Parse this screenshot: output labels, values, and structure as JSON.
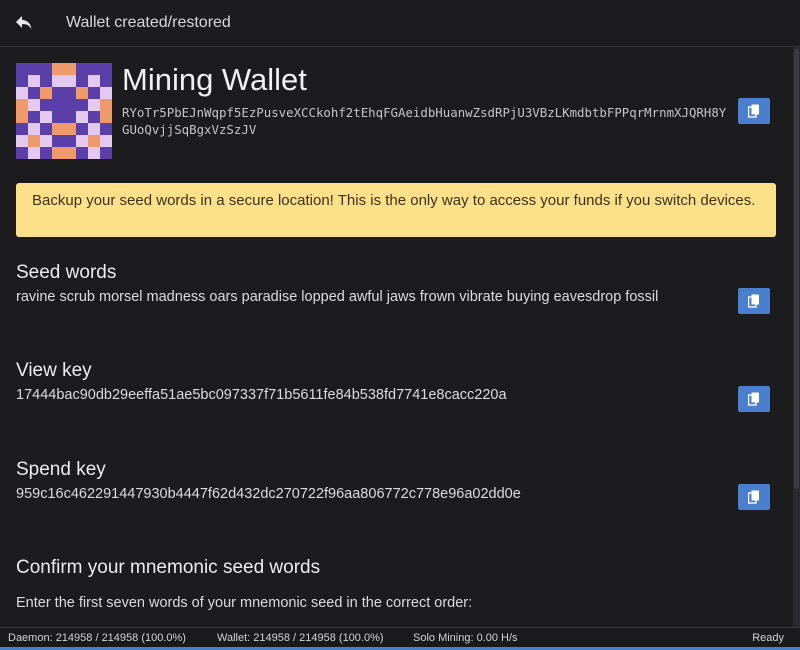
{
  "header": {
    "back_icon": "reply-arrow-icon",
    "title": "Wallet created/restored"
  },
  "wallet": {
    "name": "Mining Wallet",
    "address": "RYoTr5PbEJnWqpf5EzPusveXCCkohf2tEhqFGAeidbHuanwZsdRPjU3VBzLKmdbtbFPPqrMrnmXJQRH8YGUoQvjjSqBgxVzSzJV",
    "identicon_colors": {
      "purple": "#5b3fa8",
      "lilac": "#e3c9ef",
      "orange": "#ef9a6a"
    }
  },
  "warning": {
    "text": "Backup your seed words in a secure location! This is the only way to access your funds if you switch devices.",
    "color": "#fde08a"
  },
  "seed": {
    "title": "Seed words",
    "value": "ravine scrub morsel madness oars paradise lopped awful jaws frown vibrate buying eavesdrop fossil"
  },
  "view_key": {
    "title": "View key",
    "value": "17444bac90db29eeffa51ae5bc097337f71b5611fe84b538fd7741e8cacc220a"
  },
  "spend_key": {
    "title": "Spend key",
    "value": "959c16c462291447930b4447f62d432dc270722f96aa806772c778e96a02dd0e"
  },
  "confirm": {
    "title": "Confirm your mnemonic seed words",
    "instructions": "Enter the first seven words of your mnemonic seed in the correct order:"
  },
  "statusbar": {
    "daemon": "Daemon: 214958 / 214958 (100.0%)",
    "wallet": "Wallet: 214958 / 214958 (100.0%)",
    "mining": "Solo Mining: 0.00 H/s",
    "status": "Ready"
  },
  "colors": {
    "accent": "#4a7fd0",
    "background": "#1c1c1f"
  },
  "icons": {
    "copy": "copy-icon"
  }
}
